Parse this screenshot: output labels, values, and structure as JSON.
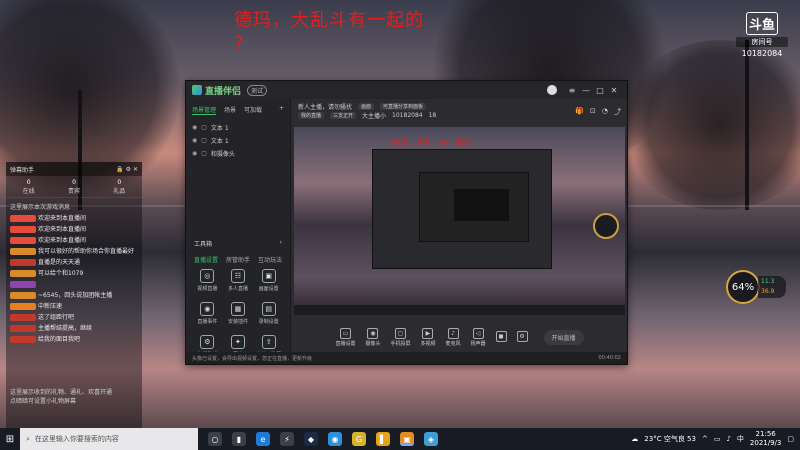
{
  "overlay": {
    "headline": "德玛，大乱斗有一起的",
    "headline_q": "?",
    "douyu": {
      "logo": "斗鱼",
      "tag": "房间号",
      "room": "10182084"
    }
  },
  "chat": {
    "title": "弹幕助手",
    "tabs": [
      {
        "num": "0",
        "label": "在线"
      },
      {
        "num": "0",
        "label": "贵宾"
      },
      {
        "num": "0",
        "label": "礼品"
      }
    ],
    "notice": "这里展示本次游戏消息",
    "lines": [
      {
        "badge": "",
        "badge_color": "#e64c3c",
        "nick": "",
        "msg": "欢迎来到本直播间"
      },
      {
        "badge": "",
        "badge_color": "#e64c3c",
        "nick": "",
        "msg": "欢迎来到本直播间"
      },
      {
        "badge": "",
        "badge_color": "#e64c3c",
        "nick": "",
        "msg": "欢迎来到本直播间"
      },
      {
        "badge": "",
        "badge_color": "#d98b2b",
        "nick": "",
        "msg": "我可以很好的帮助你场合你直播最好"
      },
      {
        "badge": "",
        "badge_color": "#c0392b",
        "nick": "",
        "msg": "直播是的天天通"
      },
      {
        "badge": "",
        "badge_color": "#d98b2b",
        "nick": "",
        "msg": "可以给个和1079"
      },
      {
        "badge": "",
        "badge_color": "#8e44ad",
        "nick": "",
        "msg": ""
      },
      {
        "badge": "",
        "badge_color": "#d98b2b",
        "nick": "",
        "msg": "~6545，回头说加团帐主播"
      },
      {
        "badge": "",
        "badge_color": "#e67e22",
        "nick": "",
        "msg": "中新压速"
      },
      {
        "badge": "",
        "badge_color": "#c0392b",
        "nick": "",
        "msg": "这了组距行吧"
      },
      {
        "badge": "",
        "badge_color": "#c0392b",
        "nick": "",
        "msg": "主播帮结提高，继续"
      },
      {
        "badge": "",
        "badge_color": "#c0392b",
        "nick": "",
        "msg": "给我的面目我吧"
      }
    ],
    "footer_1": "这里展示收到的礼物、通礼、欢喜开通",
    "footer_2": "点暗暗可设置小礼物屏幕"
  },
  "app": {
    "title": "直播伴侣",
    "beta": "测试",
    "left_tabs": [
      "场景管理",
      "场景",
      "可加载",
      "+"
    ],
    "scenes": [
      {
        "label": "文本 1"
      },
      {
        "label": "文本 1"
      },
      {
        "label": "和摄像头"
      }
    ],
    "tool_head": "工具箱",
    "tool_tabs": [
      "直播设置",
      "房管助手",
      "互动玩法"
    ],
    "tools": [
      {
        "icon": "◎",
        "label": "视频直播"
      },
      {
        "icon": "☷",
        "label": "多人直播"
      },
      {
        "icon": "▣",
        "label": "画面设置"
      },
      {
        "icon": "◉",
        "label": "直播事件"
      },
      {
        "icon": "▦",
        "label": "安装插件"
      },
      {
        "icon": "▤",
        "label": "录制设置"
      },
      {
        "icon": "⚙",
        "label": "主播助手"
      },
      {
        "icon": "✦",
        "label": "更多"
      },
      {
        "icon": "⇪",
        "label": "上传一键同"
      }
    ],
    "status_left": "头像已设置，会导出视频设置，您正在直播，更新升级",
    "status_right": "00:40:02",
    "main_title": "新人主播，请勿骚扰",
    "main_chip": "画面",
    "main_chip2": "可直播分享到面板",
    "main_row2_chip1": "我的直播",
    "main_row2_chip2": "三支正开",
    "main_row2_items": [
      "大主播小",
      "10182084",
      "18"
    ],
    "preview_red": "德玛，大乱斗有一起的",
    "controls": [
      {
        "icon": "▭",
        "label": "直播设置"
      },
      {
        "icon": "◉",
        "label": "摄像头"
      },
      {
        "icon": "▢",
        "label": "手机投屏"
      },
      {
        "icon": "▶",
        "label": "多视频"
      },
      {
        "icon": "♪",
        "label": "麦克风"
      },
      {
        "icon": "◁",
        "label": "扬声器"
      },
      {
        "icon": "◼",
        "label": ""
      },
      {
        "icon": "⚙",
        "label": ""
      }
    ],
    "start_label": "开始直播"
  },
  "gauge": {
    "value": "64%",
    "up": "11.3",
    "down": "36.9"
  },
  "taskbar": {
    "search_placeholder": "在这里输入你要搜索的内容",
    "weather": "23°C 空气良 53",
    "lang": "中",
    "time": "21:56",
    "date": "2021/9/3",
    "apps": [
      {
        "icon": "○",
        "color": "#3b3f48"
      },
      {
        "icon": "▮",
        "color": "#3b3f48"
      },
      {
        "icon": "e",
        "color": "#1f7bd6"
      },
      {
        "icon": "⚡",
        "color": "#3b3f48"
      },
      {
        "icon": "◆",
        "color": "#1c2a46"
      },
      {
        "icon": "◉",
        "color": "#2f8fd8"
      },
      {
        "icon": "G",
        "color": "#d8b12f"
      },
      {
        "icon": "▌",
        "color": "#e6a21a"
      },
      {
        "icon": "▣",
        "color": "#e38b23"
      },
      {
        "icon": "◈",
        "color": "#3f9cd6"
      }
    ]
  }
}
